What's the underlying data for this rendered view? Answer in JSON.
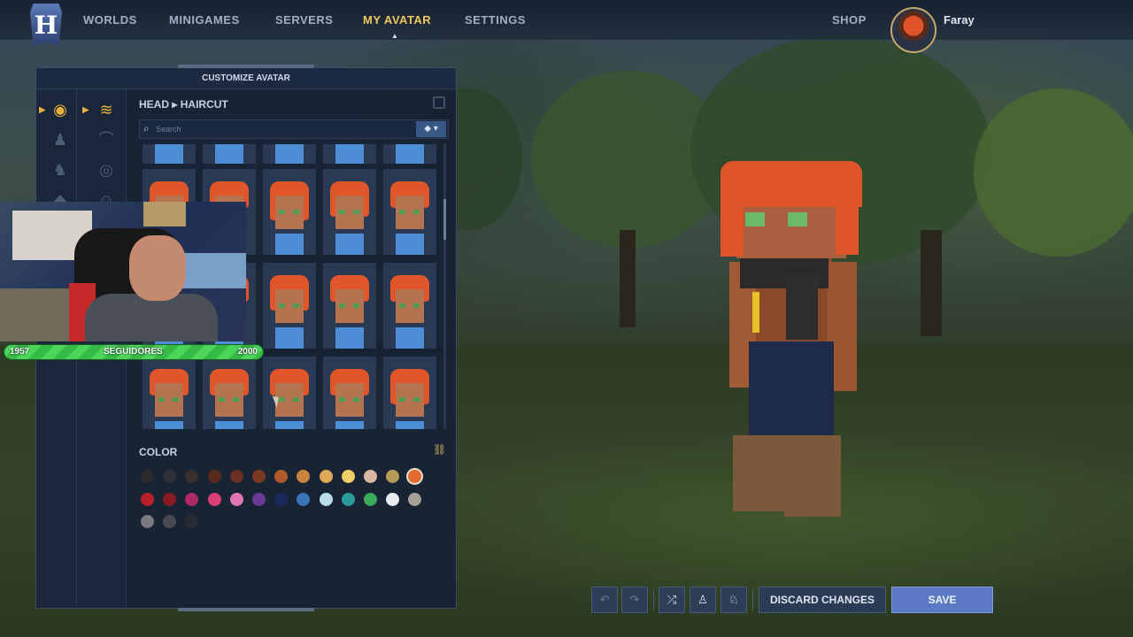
{
  "nav": {
    "logo_letter": "H",
    "items": [
      {
        "label": "WORLDS",
        "active": false
      },
      {
        "label": "MINIGAMES",
        "active": false
      },
      {
        "label": "SERVERS",
        "active": false
      },
      {
        "label": "MY AVATAR",
        "active": true
      },
      {
        "label": "SETTINGS",
        "active": false
      }
    ],
    "shop_label": "SHOP",
    "user_name": "Faray"
  },
  "panel": {
    "title": "CUSTOMIZE AVATAR",
    "breadcrumb": {
      "category": "HEAD",
      "separator": "▸",
      "subcategory": "HAIRCUT"
    },
    "search_placeholder": "Search",
    "filter_icon": "tag-filter-icon",
    "color_label": "COLOR",
    "selected_color": "#e06a30",
    "colors": [
      "#2a2a2a",
      "#303038",
      "#3a2f2d",
      "#5a2a1c",
      "#6a2e22",
      "#7a3a22",
      "#b05a2c",
      "#c9853e",
      "#e0a95a",
      "#f0cf68",
      "#d8b6a0",
      "#b79a5a",
      "#e06a30",
      "#b8202a",
      "#8a1a24",
      "#b02a64",
      "#d84074",
      "#e276b4",
      "#6a3a94",
      "#1a2a5a",
      "#3a74b8",
      "#b8dce8",
      "#2a9a9a",
      "#3aaa5a",
      "#e8ecf0",
      "#a8a096",
      "#7a7a80",
      "#4a4a52",
      "#2a2a32"
    ]
  },
  "stream": {
    "followers_current": "1957",
    "followers_label": "SEGUIDORES",
    "followers_goal": "2000",
    "followers_progress": 0.9785
  },
  "toolbar": {
    "undo_icon": "undo-icon",
    "redo_icon": "redo-icon",
    "shuffle_icon": "shuffle-icon",
    "discard_label": "DISCARD CHANGES",
    "save_label": "SAVE"
  },
  "colors": {
    "accent": "#f0c85a",
    "save": "#5c7ac4",
    "panel": "#172234"
  }
}
